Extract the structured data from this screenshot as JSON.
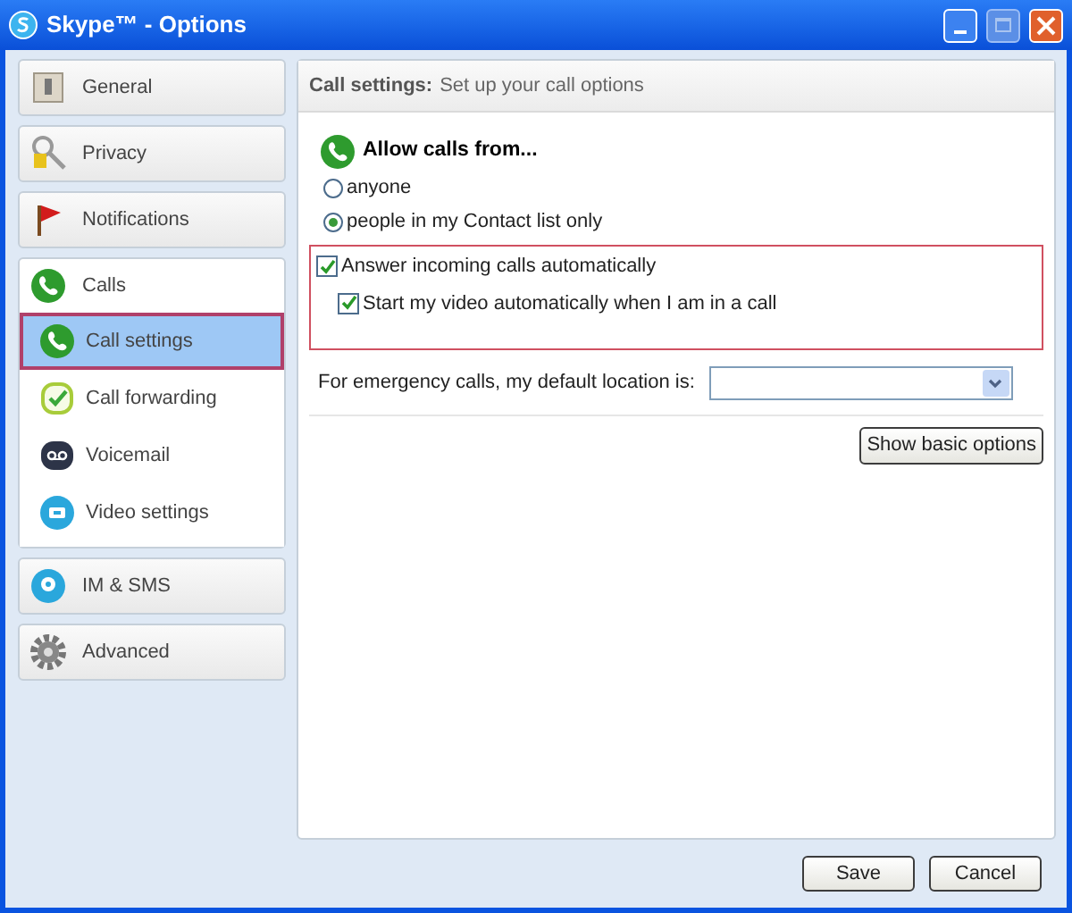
{
  "window": {
    "title": "Skype™ - Options"
  },
  "sidebar": {
    "sections": [
      {
        "label": "General",
        "selected": false
      },
      {
        "label": "Privacy",
        "selected": false
      },
      {
        "label": "Notifications",
        "selected": false
      },
      {
        "label": "Calls",
        "selected": false,
        "expanded": true,
        "children": [
          {
            "label": "Call settings",
            "selected": true
          },
          {
            "label": "Call forwarding",
            "selected": false
          },
          {
            "label": "Voicemail",
            "selected": false
          },
          {
            "label": "Video settings",
            "selected": false
          }
        ]
      },
      {
        "label": "IM & SMS",
        "selected": false
      },
      {
        "label": "Advanced",
        "selected": false
      }
    ]
  },
  "panel": {
    "title": "Call settings:",
    "subtitle": "Set up your call options",
    "allow_heading": "Allow calls from...",
    "allow_options": [
      {
        "label": "anyone",
        "selected": false
      },
      {
        "label": "people in my Contact list only",
        "selected": true
      }
    ],
    "checkboxes": [
      {
        "label": "Answer incoming calls automatically",
        "checked": true,
        "children": [
          {
            "label": "Start my video automatically when I am in a call",
            "checked": true
          }
        ]
      }
    ],
    "location_label": "For emergency calls, my default location is:",
    "basic_button": "Show basic options"
  },
  "buttons": [
    "Save",
    "Cancel"
  ]
}
